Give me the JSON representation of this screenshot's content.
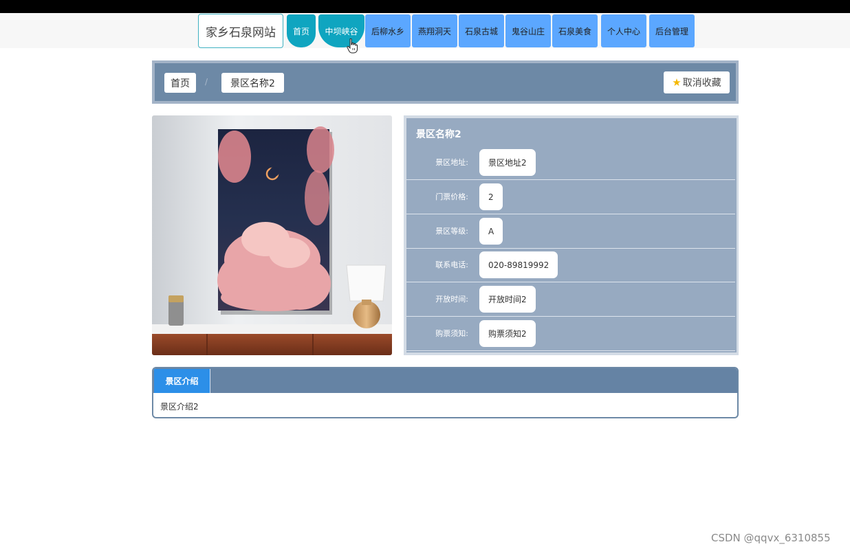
{
  "site": {
    "logo": "家乡石泉网站"
  },
  "nav": {
    "items": [
      {
        "label": "首页"
      },
      {
        "label": "中坝峡谷"
      },
      {
        "label": "后柳水乡"
      },
      {
        "label": "燕翔洞天"
      },
      {
        "label": "石泉古城"
      },
      {
        "label": "鬼谷山庄"
      },
      {
        "label": "石泉美食"
      },
      {
        "label": "个人中心"
      },
      {
        "label": "后台管理"
      }
    ],
    "active": "中坝峡谷"
  },
  "breadcrumb": {
    "home": "首页",
    "separator": "/",
    "current": "景区名称2",
    "favorite_label": "取消收藏",
    "favorite_icon": "star-icon"
  },
  "detail": {
    "title": "景区名称2",
    "fields": [
      {
        "label": "景区地址:",
        "value": "景区地址2"
      },
      {
        "label": "门票价格:",
        "value": "2"
      },
      {
        "label": "景区等级:",
        "value": "A"
      },
      {
        "label": "联系电话:",
        "value": "020-89819992"
      },
      {
        "label": "开放时间:",
        "value": "开放时间2"
      },
      {
        "label": "购票须知:",
        "value": "购票须知2"
      }
    ]
  },
  "intro": {
    "tab_label": "景区介绍",
    "content": "景区介绍2"
  },
  "watermark": "CSDN @qqvx_6310855",
  "colors": {
    "nav_button": "#5ba7ff",
    "nav_active": "#0fa5c0",
    "panel": "#6d89a6",
    "info_panel": "#97aac1",
    "tab_active": "#2c8fe8"
  }
}
